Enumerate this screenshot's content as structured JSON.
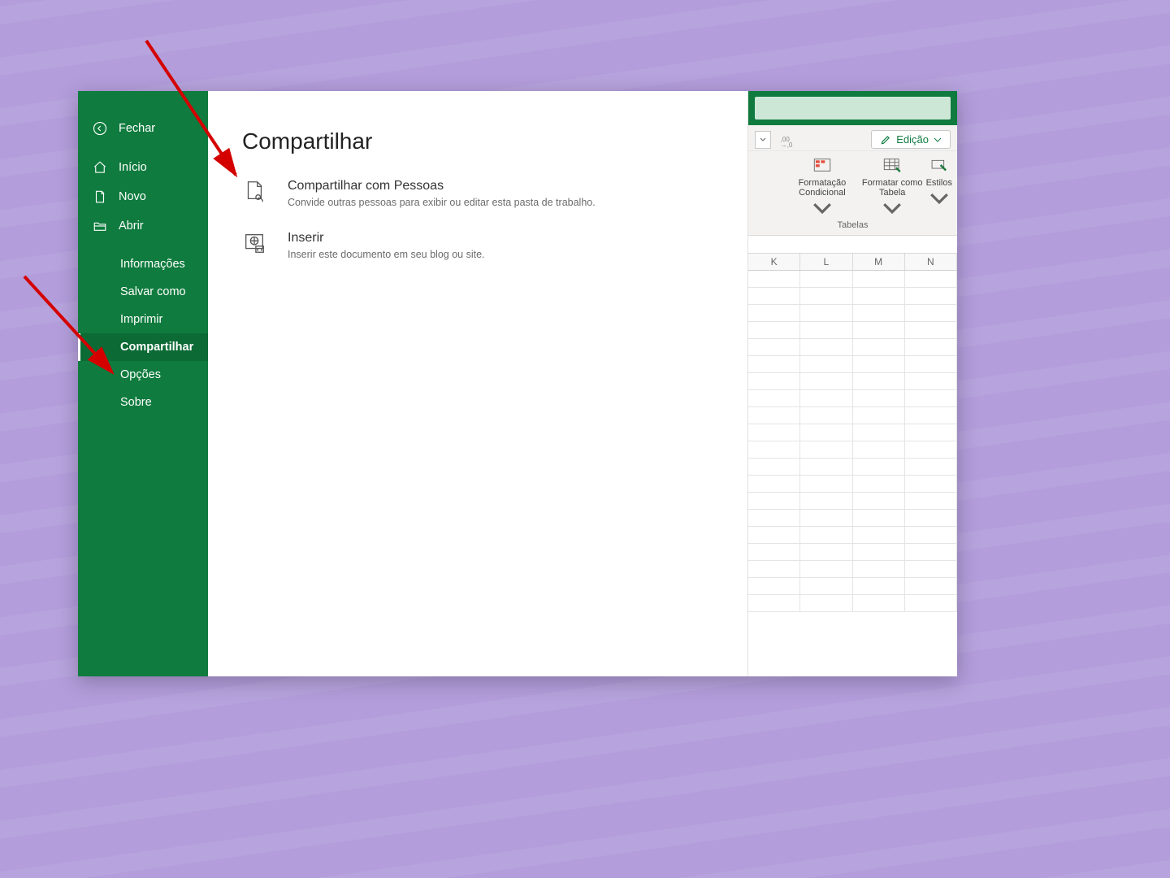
{
  "sidebar": {
    "close": "Fechar",
    "home": "Início",
    "new": "Novo",
    "open": "Abrir",
    "info": "Informações",
    "save_as": "Salvar como",
    "print": "Imprimir",
    "share": "Compartilhar",
    "options": "Opções",
    "about": "Sobre"
  },
  "main": {
    "title": "Compartilhar",
    "share_people": {
      "title": "Compartilhar com Pessoas",
      "desc": "Convide outras pessoas para exibir ou editar esta pasta de trabalho."
    },
    "embed": {
      "title": "Inserir",
      "desc": "Inserir este documento em seu blog ou site."
    }
  },
  "ribbon": {
    "edit_button": "Edição",
    "decimals_symbol": ",00\n,0",
    "cond_format": "Formatação Condicional",
    "format_table": "Formatar como Tabela",
    "styles": "Estilos",
    "group": "Tabelas",
    "columns": [
      "K",
      "L",
      "M",
      "N"
    ]
  }
}
